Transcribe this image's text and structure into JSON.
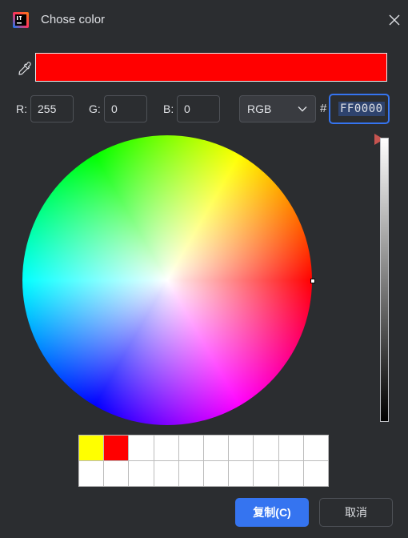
{
  "window": {
    "title": "Chose color",
    "app_icon": "intellij-icon",
    "close_icon": "close-icon"
  },
  "preview": {
    "color": "#FF0000",
    "picker_icon": "eyedropper-icon"
  },
  "rgb": {
    "r_label": "R:",
    "r_value": "255",
    "g_label": "G:",
    "g_value": "0",
    "b_label": "B:",
    "b_value": "0"
  },
  "mode": {
    "selected": "RGB",
    "icon": "chevron-down-icon"
  },
  "hex": {
    "prefix": "#",
    "value": "FF0000"
  },
  "color_wheel": {
    "hue_degrees": 0,
    "saturation": 1.0
  },
  "brightness": {
    "value": 1.0,
    "arrow_icon": "triangle-right-icon"
  },
  "recent_colors": [
    "#FFFF00",
    "#FF0000",
    "#FFFFFF",
    "#FFFFFF",
    "#FFFFFF",
    "#FFFFFF",
    "#FFFFFF",
    "#FFFFFF",
    "#FFFFFF",
    "#FFFFFF",
    "#FFFFFF",
    "#FFFFFF",
    "#FFFFFF",
    "#FFFFFF",
    "#FFFFFF",
    "#FFFFFF",
    "#FFFFFF",
    "#FFFFFF",
    "#FFFFFF",
    "#FFFFFF"
  ],
  "buttons": {
    "copy": "复制(C)",
    "cancel": "取消"
  },
  "colors": {
    "accent": "#3574F0",
    "background": "#2B2D30",
    "text": "#DFE1E5"
  }
}
